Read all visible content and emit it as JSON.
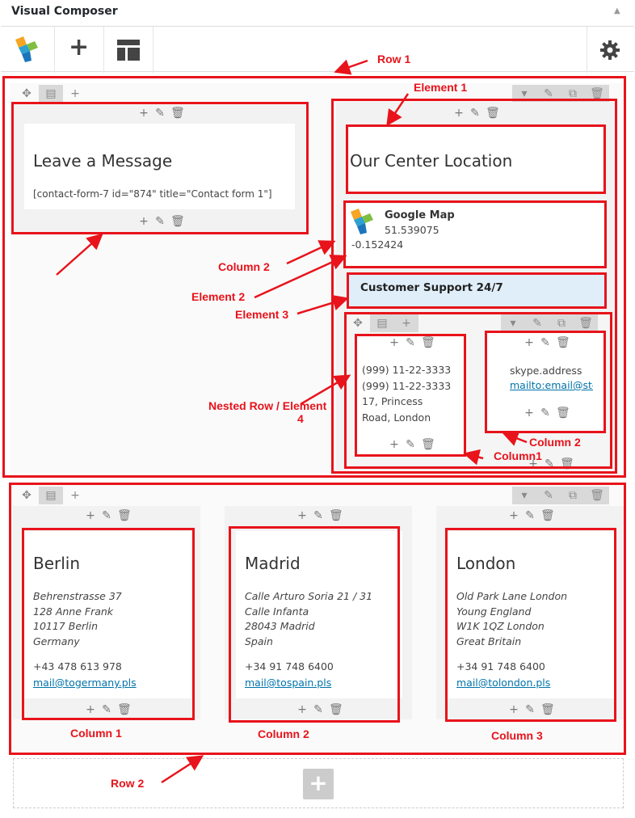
{
  "app": {
    "title": "Visual Composer"
  },
  "toolbar": {
    "logo": "vc-logo-icon",
    "add": "+",
    "templates": "templates-icon",
    "settings": "gear-icon"
  },
  "row1": {
    "col1": {
      "heading": "Leave a Message",
      "shortcode": "[contact-form-7 id=\"874\" title=\"Contact form 1\"]"
    },
    "col2": {
      "heading": "Our Center Location",
      "map": {
        "title": "Google Map",
        "lat": "51.539075",
        "lng": "-0.152424"
      },
      "support_title": "Customer Support 24/7",
      "nested": {
        "col1_lines": [
          "(999) 11-22-3333",
          "(999) 11-22-3333",
          "17, Princess",
          "Road, London"
        ],
        "col2_skype": "skype.address",
        "col2_mail": "mailto:email@stc"
      }
    }
  },
  "row2": {
    "columns": [
      {
        "city": "Berlin",
        "addr": [
          "Behrenstrasse 37",
          "128 Anne Frank",
          "10117 Berlin",
          "Germany"
        ],
        "phone": "+43 478 613 978",
        "email": "mail@togermany.pls"
      },
      {
        "city": "Madrid",
        "addr": [
          "Calle Arturo Soria 21 / 31",
          "Calle Infanta",
          "28043 Madrid",
          "Spain"
        ],
        "phone": "+34 91 748 6400",
        "email": "mail@tospain.pls"
      },
      {
        "city": "London",
        "addr": [
          "Old Park Lane London",
          "Young England",
          "W1K 1QZ London",
          "Great Britain"
        ],
        "phone": "+34 91 748 6400",
        "email": "mail@tolondon.pls"
      }
    ]
  },
  "annotations": {
    "row1": "Row 1",
    "element1": "Element 1",
    "column2": "Column 2",
    "element2": "Element 2",
    "element3": "Element 3",
    "nested1": "Nested Row / Element",
    "nested2": "4",
    "nested_col2": "Column 2",
    "nested_col1": "Column1",
    "r2col1": "Column 1",
    "r2col2": "Column 2",
    "r2col3": "Column 3",
    "row2": "Row 2"
  },
  "controls": {
    "add": "+",
    "edit": "✎",
    "delete": "🗑",
    "move": "✥",
    "layout": "▤",
    "chevron": "▾",
    "clone": "⧉"
  }
}
